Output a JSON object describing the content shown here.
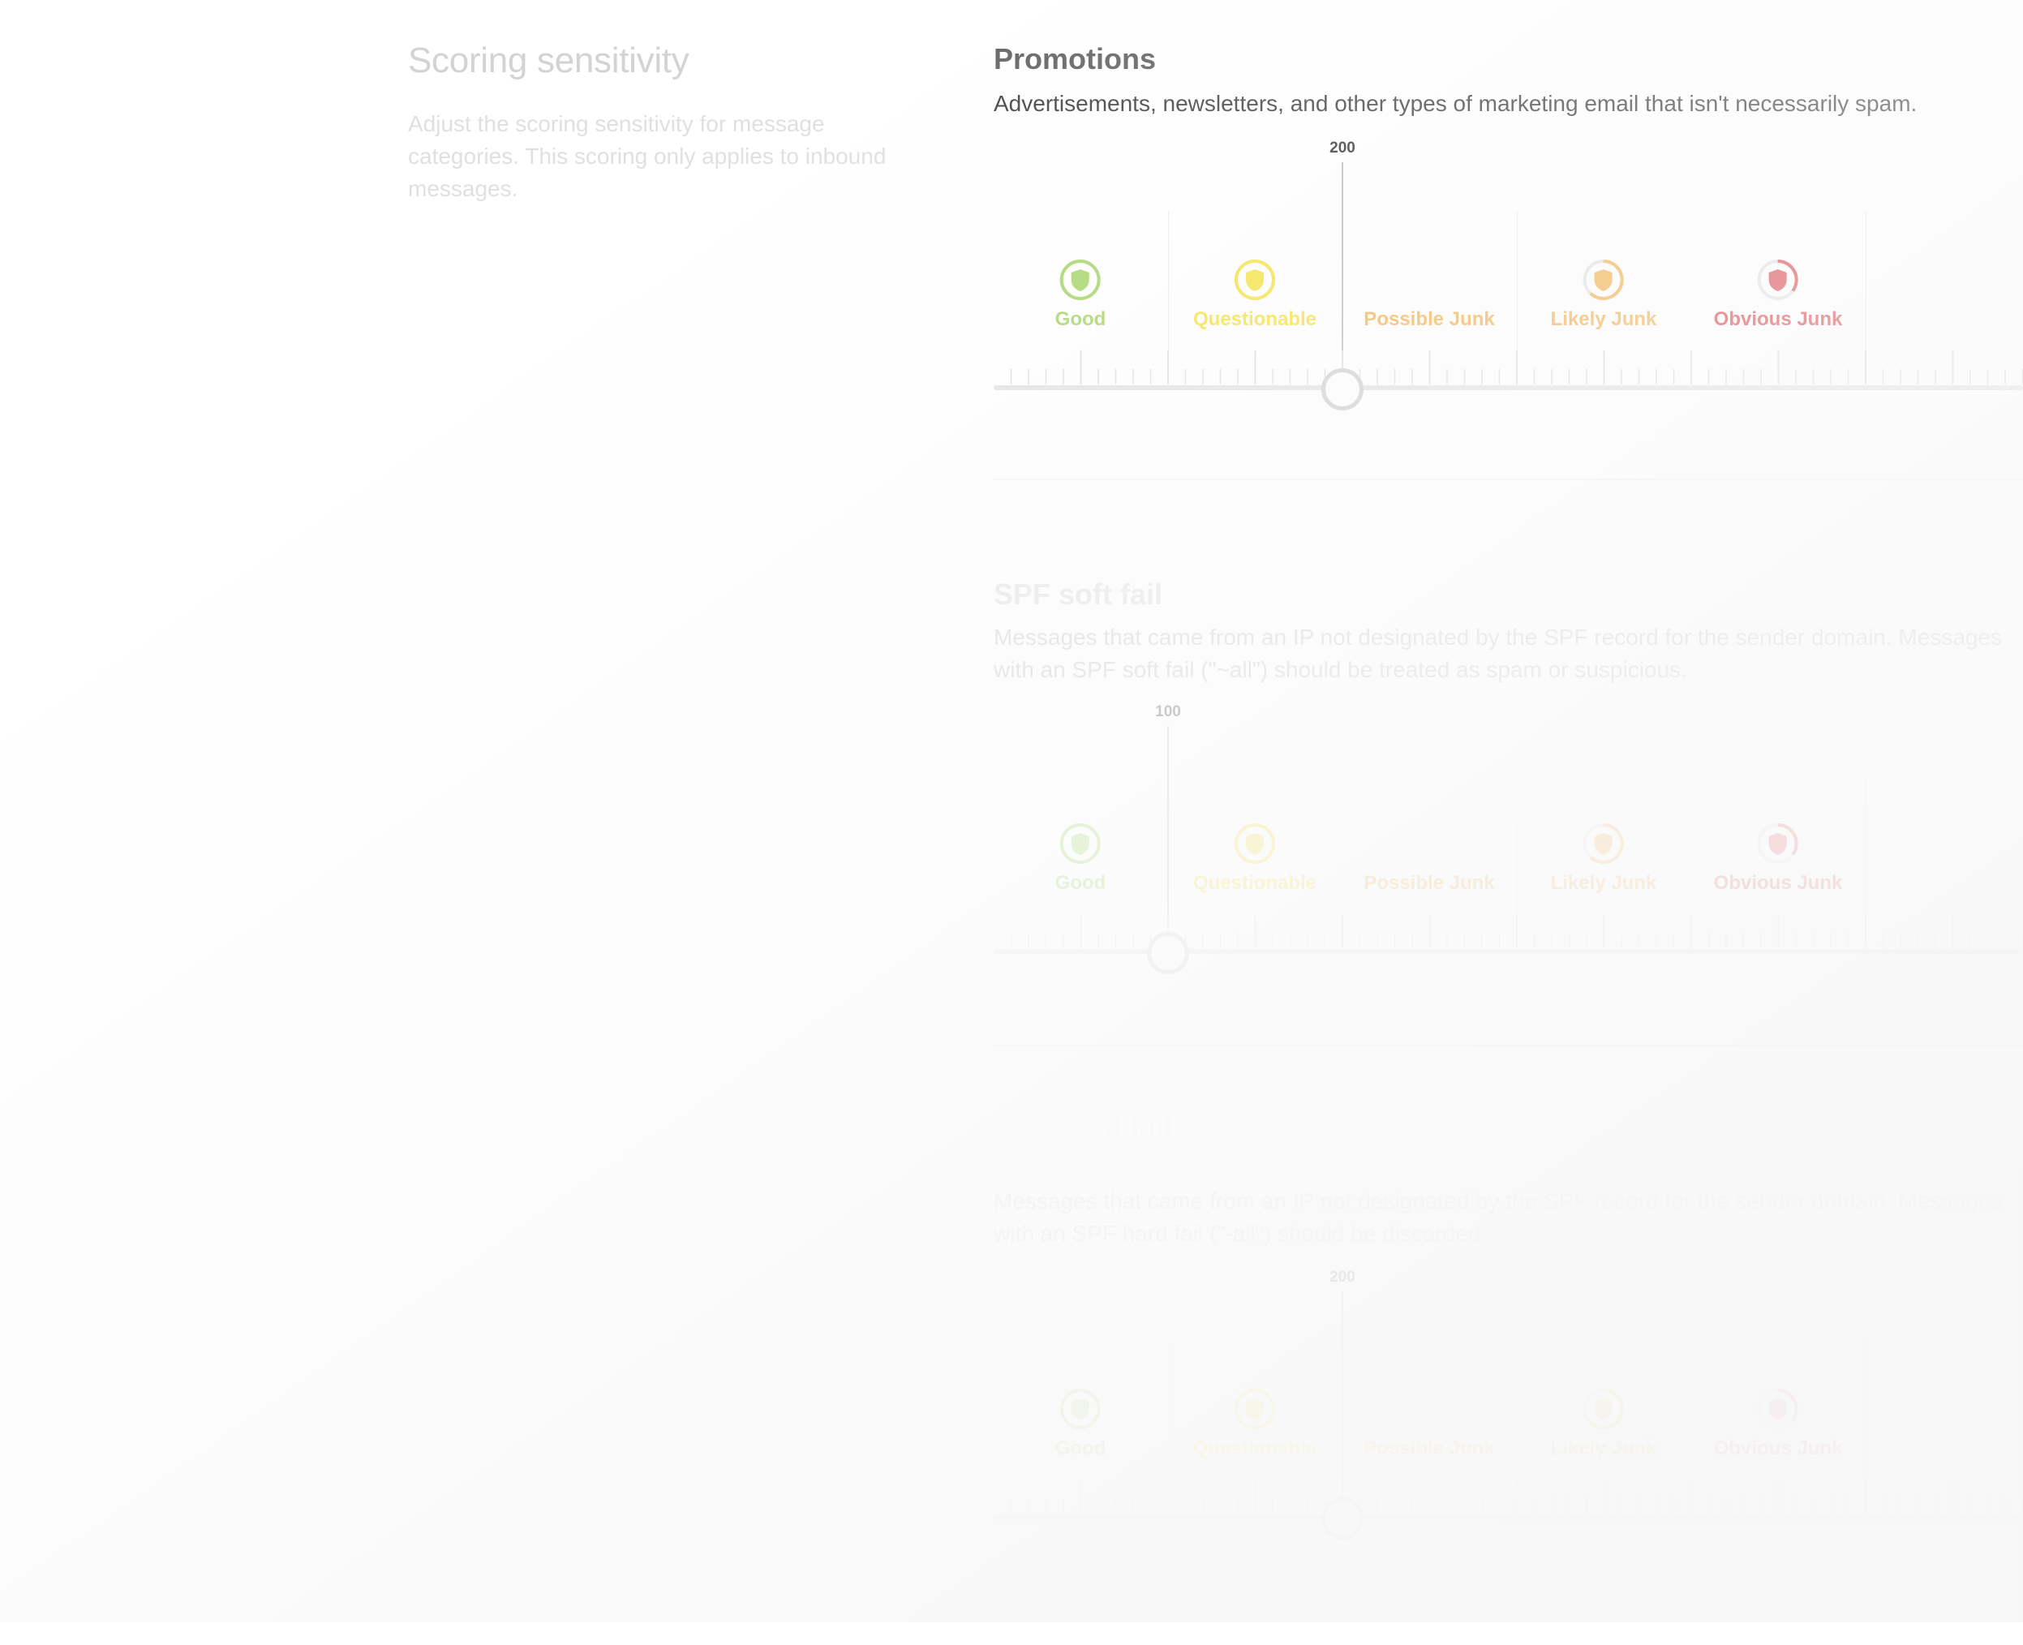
{
  "left": {
    "title": "Scoring sensitivity",
    "description": "Adjust the scoring sensitivity for message categories. This scoring only applies to inbound messages."
  },
  "categories_labels": [
    "Good",
    "Questionable",
    "Possible Junk",
    "Likely Junk",
    "Obvious Junk"
  ],
  "colors": {
    "good": "#a5d568",
    "questionable": "#f5e23b",
    "possible_junk": "#f4b14e",
    "likely_junk": "#f4b14e",
    "obvious_junk": "#d9434a"
  },
  "sections": [
    {
      "title": "Promotions",
      "description": "Advertisements, newsletters, and other types of marketing email that isn't necessarily spam.",
      "value": "200",
      "slider_value": 200,
      "opacity": 1.0,
      "labels": [
        "Good",
        "Questionable",
        "Possible Junk",
        "Likely Junk",
        "Obvious Junk"
      ]
    },
    {
      "title": "SPF soft fail",
      "description": "Messages that came from an IP not designated by the SPF record for the sender domain. Messages with an SPF soft fail (\"~all\") should be treated as spam or suspicious.",
      "value": "100",
      "slider_value": 100,
      "opacity": 0.45,
      "labels": [
        "Good",
        "Questionable",
        "Possible Junk",
        "Likely Junk",
        "Obvious Junk"
      ]
    },
    {
      "title": "SPF hard fail",
      "description": "Messages that came from an IP not designated by the SPF record for the sender domain. Messages with an SPF hard fail (\"-all\") should be discarded.",
      "value": "200",
      "slider_value": 200,
      "opacity": 0.22,
      "labels": [
        "Good",
        "Questionable",
        "Possible Junk",
        "Likely Junk",
        "Obvious Junk"
      ]
    }
  ],
  "icons": {
    "good": "shield-check-icon",
    "questionable": "shield-icon",
    "possible_junk": "shield-warning-icon",
    "likely_junk": "shield-warning-icon",
    "obvious_junk": "shield-danger-icon"
  }
}
